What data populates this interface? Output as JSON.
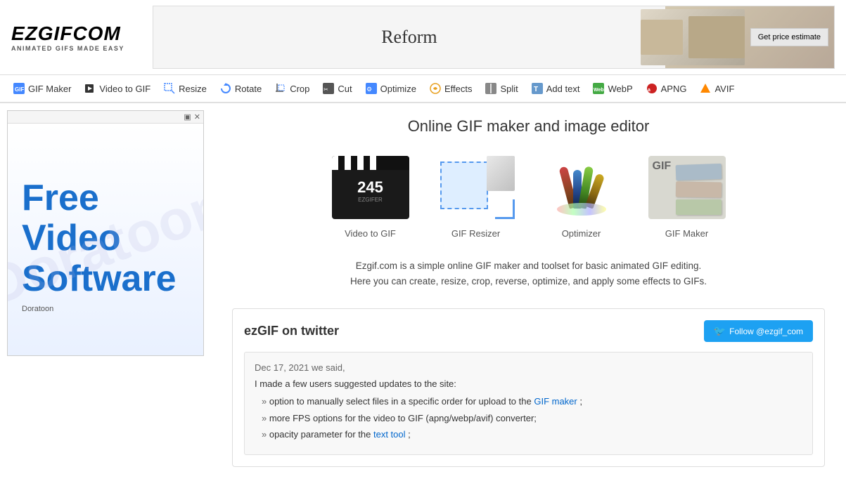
{
  "site": {
    "name": "EZGIFCOM",
    "tagline": "ANIMATED GIFS MADE EASY"
  },
  "ad_banner": {
    "text": "Reform",
    "button_label": "Get price estimate"
  },
  "nav": {
    "items": [
      {
        "label": "GIF Maker",
        "icon": "gif-maker-icon",
        "href": "#"
      },
      {
        "label": "Video to GIF",
        "icon": "video-icon",
        "href": "#"
      },
      {
        "label": "Resize",
        "icon": "resize-icon",
        "href": "#"
      },
      {
        "label": "Rotate",
        "icon": "rotate-icon",
        "href": "#"
      },
      {
        "label": "Crop",
        "icon": "crop-icon",
        "href": "#"
      },
      {
        "label": "Cut",
        "icon": "cut-icon",
        "href": "#"
      },
      {
        "label": "Optimize",
        "icon": "optimize-icon",
        "href": "#"
      },
      {
        "label": "Effects",
        "icon": "effects-icon",
        "href": "#"
      },
      {
        "label": "Split",
        "icon": "split-icon",
        "href": "#"
      },
      {
        "label": "Add text",
        "icon": "text-icon",
        "href": "#"
      },
      {
        "label": "WebP",
        "icon": "webp-icon",
        "href": "#"
      },
      {
        "label": "APNG",
        "icon": "apng-icon",
        "href": "#"
      },
      {
        "label": "AVIF",
        "icon": "avif-icon",
        "href": "#"
      }
    ]
  },
  "main": {
    "title": "Online GIF maker and image editor",
    "features": [
      {
        "label": "Video to GIF",
        "icon": "video-to-gif-icon"
      },
      {
        "label": "GIF Resizer",
        "icon": "gif-resizer-icon"
      },
      {
        "label": "Optimizer",
        "icon": "optimizer-icon"
      },
      {
        "label": "GIF Maker",
        "icon": "gif-maker-feature-icon"
      }
    ],
    "description_line1": "Ezgif.com is a simple online GIF maker and toolset for basic animated GIF editing.",
    "description_line2": "Here you can create, resize, crop, reverse, optimize, and apply some effects to GIFs."
  },
  "twitter": {
    "section_title": "ezGIF on twitter",
    "follow_label": "Follow @ezgif_com",
    "tweet": {
      "date": "Dec 17, 2021 we said,",
      "intro": "I made a few users suggested updates to the site:",
      "items": [
        {
          "text": "option to manually select files in a specific order for upload to the ",
          "link_text": "GIF maker",
          "link": "#",
          "suffix": ";"
        },
        {
          "text": "more FPS options for the video to GIF (apng/webp/avif) converter;"
        },
        {
          "text": "opacity parameter for the ",
          "link_text": "text tool",
          "link": "#",
          "suffix": ";"
        }
      ]
    }
  },
  "sidebar_ad": {
    "lines": [
      "Free",
      "Video",
      "Software"
    ],
    "watermark": "Doratoon",
    "sponsor": "Doratoon"
  }
}
